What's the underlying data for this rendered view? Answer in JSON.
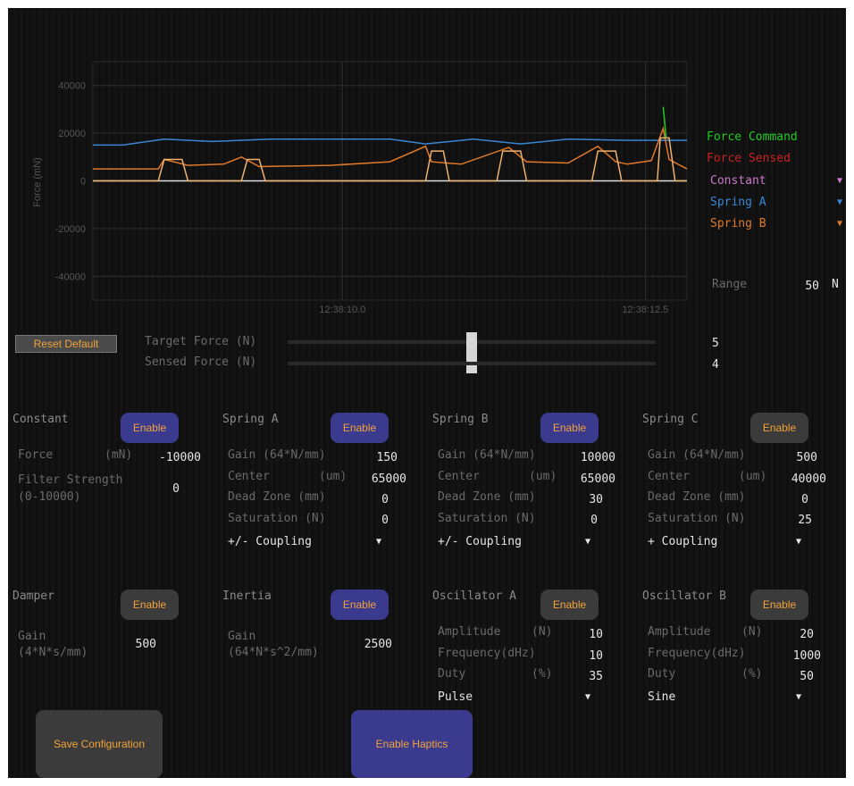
{
  "colors": {
    "force_command": "#22cc22",
    "force_sensed": "#cc2222",
    "constant": "#cc77cc",
    "spring_a": "#3a86d6",
    "spring_b": "#e07a2a",
    "accent": "#f2a23a",
    "button_enabled": "#3a3b8e",
    "button_disabled": "#3b3b3b"
  },
  "chart_data": {
    "type": "line",
    "ylabel": "Force (mN)",
    "yticks": [
      "40000",
      "20000",
      "0",
      "-20000",
      "-40000"
    ],
    "xticks": [
      "12:38:10.0",
      "12:38:12.5"
    ],
    "ylim": [
      -50000,
      50000
    ],
    "grid": true,
    "series": [
      {
        "name": "Spring A",
        "points": [
          [
            0,
            15000
          ],
          [
            0.05,
            15000
          ],
          [
            0.12,
            17500
          ],
          [
            0.2,
            16500
          ],
          [
            0.3,
            17500
          ],
          [
            0.4,
            17500
          ],
          [
            0.5,
            17500
          ],
          [
            0.56,
            15500
          ],
          [
            0.64,
            17500
          ],
          [
            0.72,
            15500
          ],
          [
            0.8,
            17500
          ],
          [
            0.9,
            17000
          ],
          [
            1,
            17000
          ]
        ]
      },
      {
        "name": "Spring B",
        "points": [
          [
            0,
            5000
          ],
          [
            0.11,
            5000
          ],
          [
            0.12,
            9000
          ],
          [
            0.16,
            6500
          ],
          [
            0.22,
            7000
          ],
          [
            0.25,
            10000
          ],
          [
            0.28,
            6000
          ],
          [
            0.4,
            6500
          ],
          [
            0.5,
            8000
          ],
          [
            0.56,
            14500
          ],
          [
            0.57,
            8000
          ],
          [
            0.62,
            7000
          ],
          [
            0.7,
            14000
          ],
          [
            0.73,
            8000
          ],
          [
            0.8,
            7500
          ],
          [
            0.85,
            14500
          ],
          [
            0.88,
            8000
          ],
          [
            0.9,
            7000
          ],
          [
            0.94,
            8500
          ],
          [
            0.96,
            22000
          ],
          [
            0.97,
            9000
          ],
          [
            1,
            5000
          ]
        ]
      },
      {
        "name": "Constant",
        "points": [
          [
            0,
            0
          ],
          [
            0.11,
            0
          ],
          [
            0.12,
            9000
          ],
          [
            0.15,
            9000
          ],
          [
            0.16,
            0
          ],
          [
            0.25,
            0
          ],
          [
            0.26,
            9000
          ],
          [
            0.28,
            9000
          ],
          [
            0.29,
            0
          ],
          [
            0.56,
            0
          ],
          [
            0.57,
            12500
          ],
          [
            0.59,
            12500
          ],
          [
            0.6,
            0
          ],
          [
            0.68,
            0
          ],
          [
            0.69,
            12500
          ],
          [
            0.72,
            12500
          ],
          [
            0.73,
            0
          ],
          [
            0.84,
            0
          ],
          [
            0.85,
            12500
          ],
          [
            0.88,
            12500
          ],
          [
            0.89,
            0
          ],
          [
            0.95,
            0
          ],
          [
            0.955,
            18000
          ],
          [
            0.97,
            18000
          ],
          [
            0.98,
            0
          ],
          [
            1,
            0
          ]
        ]
      },
      {
        "name": "Force Command",
        "points": [
          [
            0.96,
            31000
          ],
          [
            0.965,
            18000
          ]
        ]
      }
    ]
  },
  "legend": {
    "force_command": "Force Command",
    "force_sensed": "Force Sensed",
    "constant": "Constant",
    "spring_a": "Spring A",
    "spring_b": "Spring B"
  },
  "range": {
    "label": "Range",
    "value": "50",
    "unit": "N"
  },
  "reset_button": "Reset Default",
  "sliders": {
    "target_label": "Target Force (N)",
    "target_value": "5",
    "target_fraction": 0.5,
    "sensed_label": "Sensed Force (N)",
    "sensed_value": "4"
  },
  "effects": {
    "constant": {
      "title": "Constant",
      "button": "Enable",
      "force_label": "Force",
      "force_unit": "(mN)",
      "force_value": "-10000",
      "filter_label": "Filter Strength",
      "filter_range": "(0-10000)",
      "filter_value": "0"
    },
    "spring_a": {
      "title": "Spring A",
      "button": "Enable",
      "gain_label": "Gain (64*N/mm)",
      "gain": "150",
      "center_label": "Center",
      "center_unit": "(um)",
      "center": "65000",
      "dead_label": "Dead Zone (mm)",
      "dead": "0",
      "sat_label": "Saturation (N)",
      "sat": "0",
      "coupling": "+/- Coupling"
    },
    "spring_b": {
      "title": "Spring B",
      "button": "Enable",
      "gain_label": "Gain (64*N/mm)",
      "gain": "10000",
      "center_label": "Center",
      "center_unit": "(um)",
      "center": "65000",
      "dead_label": "Dead Zone (mm)",
      "dead": "30",
      "sat_label": "Saturation (N)",
      "sat": "0",
      "coupling": "+/- Coupling"
    },
    "spring_c": {
      "title": "Spring C",
      "button": "Enable",
      "gain_label": "Gain (64*N/mm)",
      "gain": "500",
      "center_label": "Center",
      "center_unit": "(um)",
      "center": "40000",
      "dead_label": "Dead Zone (mm)",
      "dead": "0",
      "sat_label": "Saturation (N)",
      "sat": "25",
      "coupling": "+ Coupling"
    },
    "damper": {
      "title": "Damper",
      "button": "Enable",
      "gain_label": "Gain",
      "gain_unit": "(4*N*s/mm)",
      "gain": "500"
    },
    "inertia": {
      "title": "Inertia",
      "button": "Enable",
      "gain_label": "Gain",
      "gain_unit": "(64*N*s^2/mm)",
      "gain": "2500"
    },
    "osc_a": {
      "title": "Oscillator A",
      "button": "Enable",
      "amp_label": "Amplitude",
      "amp_unit": "(N)",
      "amp": "10",
      "freq_label": "Frequency(dHz)",
      "freq": "10",
      "duty_label": "Duty",
      "duty_unit": "(%)",
      "duty": "35",
      "wave": "Pulse"
    },
    "osc_b": {
      "title": "Oscillator B",
      "button": "Enable",
      "amp_label": "Amplitude",
      "amp_unit": "(N)",
      "amp": "20",
      "freq_label": "Frequency(dHz)",
      "freq": "1000",
      "duty_label": "Duty",
      "duty_unit": "(%)",
      "duty": "50",
      "wave": "Sine"
    }
  },
  "save_button": "Save Configuration",
  "haptics_button": "Enable Haptics"
}
